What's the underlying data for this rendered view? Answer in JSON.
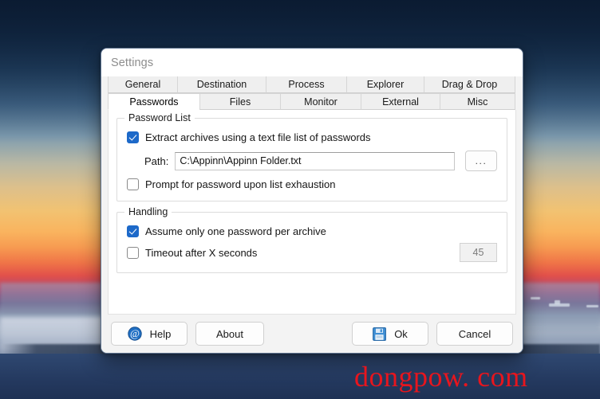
{
  "desktop": {
    "watermark": "dongpow. com"
  },
  "dialog": {
    "title": "Settings",
    "tabs_row1": [
      {
        "label": "General",
        "selected": false
      },
      {
        "label": "Destination",
        "selected": false
      },
      {
        "label": "Process",
        "selected": false
      },
      {
        "label": "Explorer",
        "selected": false
      },
      {
        "label": "Drag & Drop",
        "selected": false
      }
    ],
    "tabs_row2": [
      {
        "label": "Passwords",
        "selected": true
      },
      {
        "label": "Files",
        "selected": false
      },
      {
        "label": "Monitor",
        "selected": false
      },
      {
        "label": "External",
        "selected": false
      },
      {
        "label": "Misc",
        "selected": false
      }
    ],
    "password_list": {
      "group_title": "Password List",
      "extract_checkbox_label": "Extract archives using a text file list of passwords",
      "extract_checked": true,
      "path_label": "Path:",
      "path_value": "C:\\Appinn\\Appinn Folder.txt",
      "path_placeholder": "",
      "browse_label": "...",
      "prompt_checkbox_label": "Prompt for password upon list exhaustion",
      "prompt_checked": false
    },
    "handling": {
      "group_title": "Handling",
      "assume_checkbox_label": "Assume only one password per archive",
      "assume_checked": true,
      "timeout_checkbox_label": "Timeout after X seconds",
      "timeout_checked": false,
      "timeout_value": "45"
    },
    "buttons": {
      "help": "Help",
      "about": "About",
      "ok": "Ok",
      "cancel": "Cancel"
    },
    "icons": {
      "help": "at-sign-icon",
      "ok": "save-floppy-icon"
    },
    "colors": {
      "accent_checkbox": "#1d69c9",
      "title_text": "#8d8d8d",
      "watermark": "#e8151d",
      "dialog_bg": "#f3f3f3",
      "content_bg": "#ffffff"
    }
  }
}
